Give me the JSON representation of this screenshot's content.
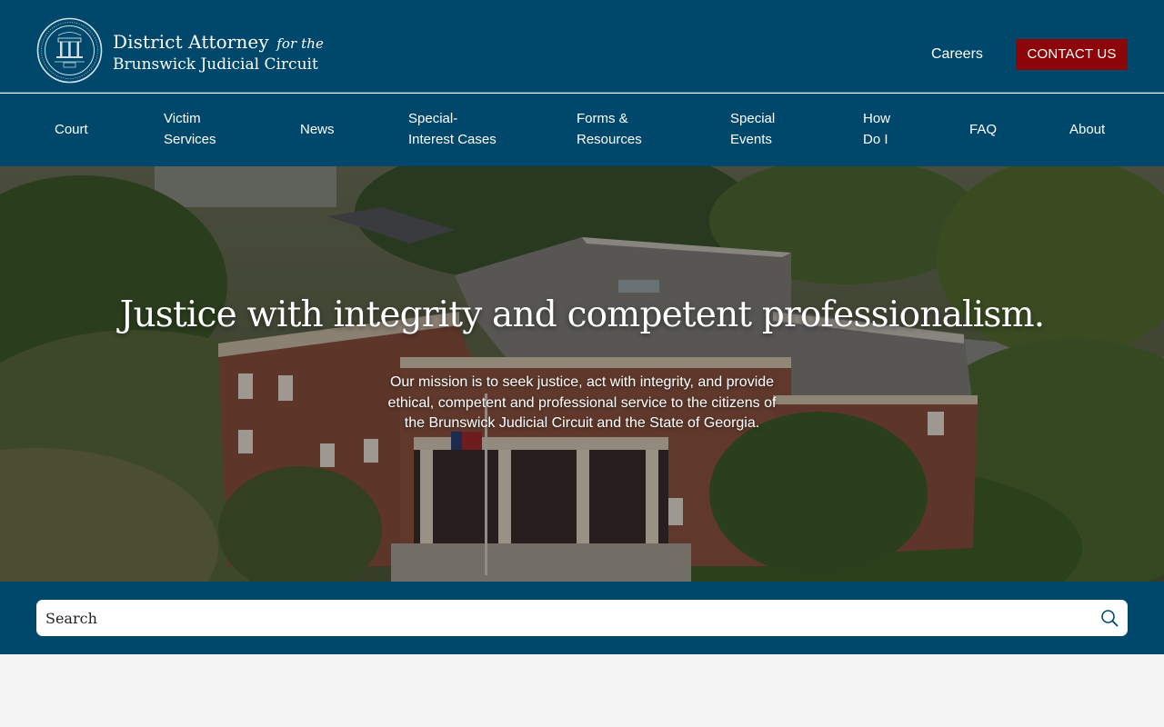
{
  "header": {
    "brand_line1": "District Attorney",
    "brand_for": "for the",
    "brand_line2": "Brunswick Judicial Circuit",
    "careers_label": "Careers",
    "contact_label": "CONTACT US"
  },
  "nav": {
    "court": "Court",
    "victim_1": "Victim",
    "victim_2": "Services",
    "news": "News",
    "special_interest_1": "Special-",
    "special_interest_2": "Interest Cases",
    "forms_1": "Forms &",
    "forms_2": "Resources",
    "events_1": "Special",
    "events_2": "Events",
    "howdoi_1": "How",
    "howdoi_2": "Do I",
    "faq": "FAQ",
    "about": "About"
  },
  "hero": {
    "title": "Justice with integrity and competent professionalism.",
    "mission": "Our mission is to seek justice, act with integrity, and provide ethical, competent and professional service to the citizens of the Brunswick Judicial Circuit and the State of Georgia."
  },
  "search": {
    "placeholder": "Search"
  },
  "colors": {
    "brand_blue": "#00486b",
    "contact_red": "#8c0508",
    "page_background": "#f3f3f3"
  },
  "icons": {
    "logo": "georgia-seal-icon",
    "search": "search-icon"
  }
}
